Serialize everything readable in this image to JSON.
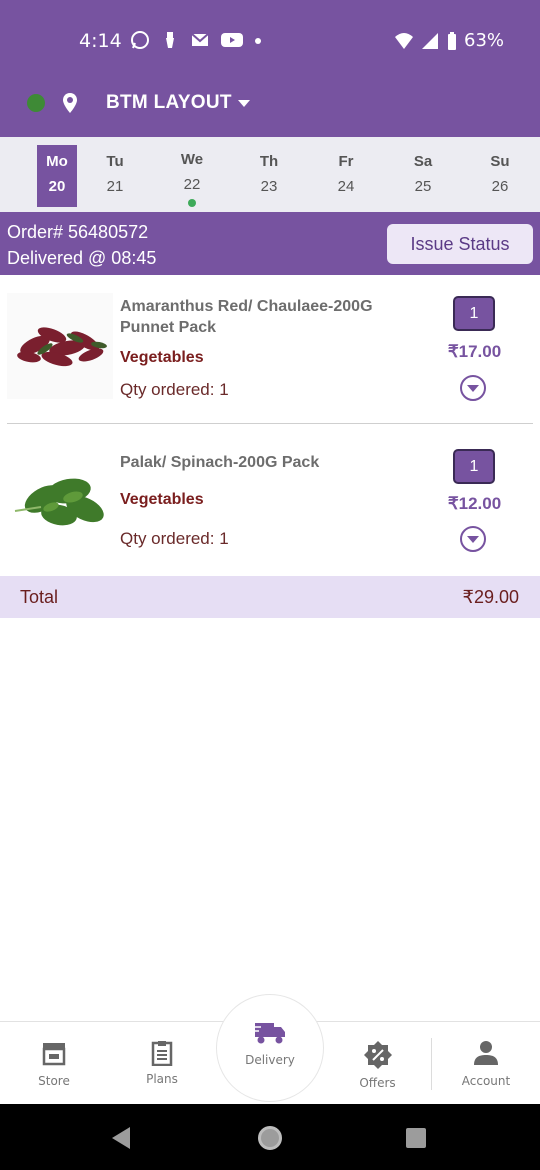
{
  "status_bar": {
    "time": "4:14",
    "battery": "63%",
    "left_icons": [
      "whatsapp-icon",
      "flashlight-notification-icon",
      "gmail-icon",
      "youtube-icon",
      "dot-icon"
    ],
    "right_icons": [
      "wifi-icon",
      "signal-icon",
      "battery-icon"
    ]
  },
  "header": {
    "location": "BTM LAYOUT",
    "status_color": "#3e8a36",
    "brand_color": "#7753a0"
  },
  "days": [
    {
      "name": "Mo",
      "num": "20",
      "selected": true,
      "marked": false
    },
    {
      "name": "Tu",
      "num": "21",
      "selected": false,
      "marked": false
    },
    {
      "name": "We",
      "num": "22",
      "selected": false,
      "marked": true
    },
    {
      "name": "Th",
      "num": "23",
      "selected": false,
      "marked": false
    },
    {
      "name": "Fr",
      "num": "24",
      "selected": false,
      "marked": false
    },
    {
      "name": "Sa",
      "num": "25",
      "selected": false,
      "marked": false
    },
    {
      "name": "Su",
      "num": "26",
      "selected": false,
      "marked": false
    }
  ],
  "order": {
    "number": "Order# 56480572",
    "delivered": "Delivered @ 08:45",
    "issue_button": "Issue Status"
  },
  "items": [
    {
      "name": "Amaranthus Red/ Chaulaee-200G Punnet Pack",
      "category": "Vegetables",
      "qty_ordered": "Qty ordered: 1",
      "qty": "1",
      "price": "₹17.00"
    },
    {
      "name": "Palak/ Spinach-200G Pack",
      "category": "Vegetables",
      "qty_ordered": "Qty ordered: 1",
      "qty": "1",
      "price": "₹12.00"
    }
  ],
  "total": {
    "label": "Total",
    "amount": "₹29.00"
  },
  "bottom_nav": [
    {
      "label": "Store",
      "icon": "store-icon"
    },
    {
      "label": "Plans",
      "icon": "clipboard-icon"
    },
    {
      "label": "Delivery",
      "icon": "delivery-truck-icon"
    },
    {
      "label": "Offers",
      "icon": "offer-badge-icon"
    },
    {
      "label": "Account",
      "icon": "person-icon"
    }
  ]
}
